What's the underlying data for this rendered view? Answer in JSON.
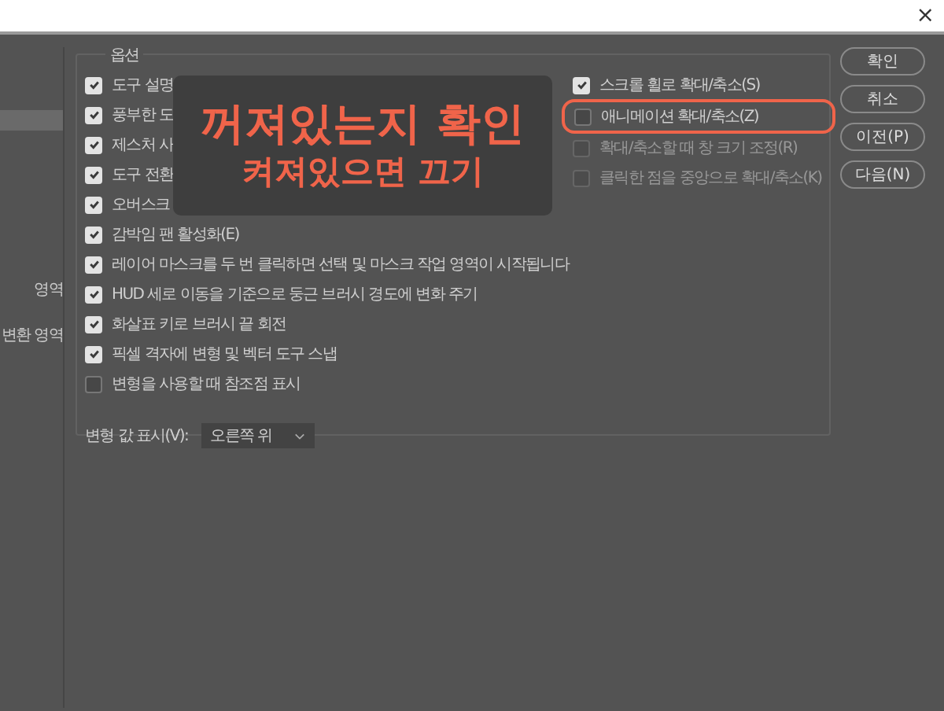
{
  "window": {
    "close": "×"
  },
  "sidebar": {
    "items": [
      {
        "label": "영역"
      },
      {
        "label": "변환 영역"
      }
    ]
  },
  "options": {
    "legend": "옵션",
    "left": [
      {
        "label": "도구 설명",
        "checked": true
      },
      {
        "label": "풍부한 도",
        "checked": true
      },
      {
        "label": "제스처 사",
        "checked": true
      },
      {
        "label": "도구 전환",
        "checked": true
      },
      {
        "label": "오버스크",
        "checked": true
      },
      {
        "label": "감박임 팬 활성화(E)",
        "checked": true
      },
      {
        "label": "레이어 마스크를 두 번 클릭하면 선택 및 마스크 작업 영역이 시작됩니다",
        "checked": true
      },
      {
        "label": "HUD 세로 이동을 기준으로 둥근 브러시 경도에 변화 주기",
        "checked": true
      },
      {
        "label": "화살표 키로 브러시 끝 회전",
        "checked": true
      },
      {
        "label": "픽셀 격자에 변형 및 벡터 도구 스냅",
        "checked": true
      },
      {
        "label": "변형을 사용할 때 참조점 표시",
        "checked": false
      }
    ],
    "right": [
      {
        "label": "스크롤 휠로 확대/축소(S)",
        "checked": true,
        "disabled": false,
        "highlighted": false
      },
      {
        "label": "애니메이션 확대/축소(Z)",
        "checked": false,
        "disabled": false,
        "highlighted": true
      },
      {
        "label": "확대/축소할 때 창 크기 조정(R)",
        "checked": false,
        "disabled": true,
        "highlighted": false
      },
      {
        "label": "클릭한 점을 중앙으로 확대/축소(K)",
        "checked": false,
        "disabled": true,
        "highlighted": false
      }
    ],
    "transform_label": "변형 값 표시(V):",
    "transform_value": "오른쪽 위"
  },
  "buttons": [
    "확인",
    "취소",
    "이전(P)",
    "다음(N)"
  ],
  "annotation": {
    "title": "꺼져있는지 확인",
    "subtitle": "켜져있으면 끄기"
  }
}
